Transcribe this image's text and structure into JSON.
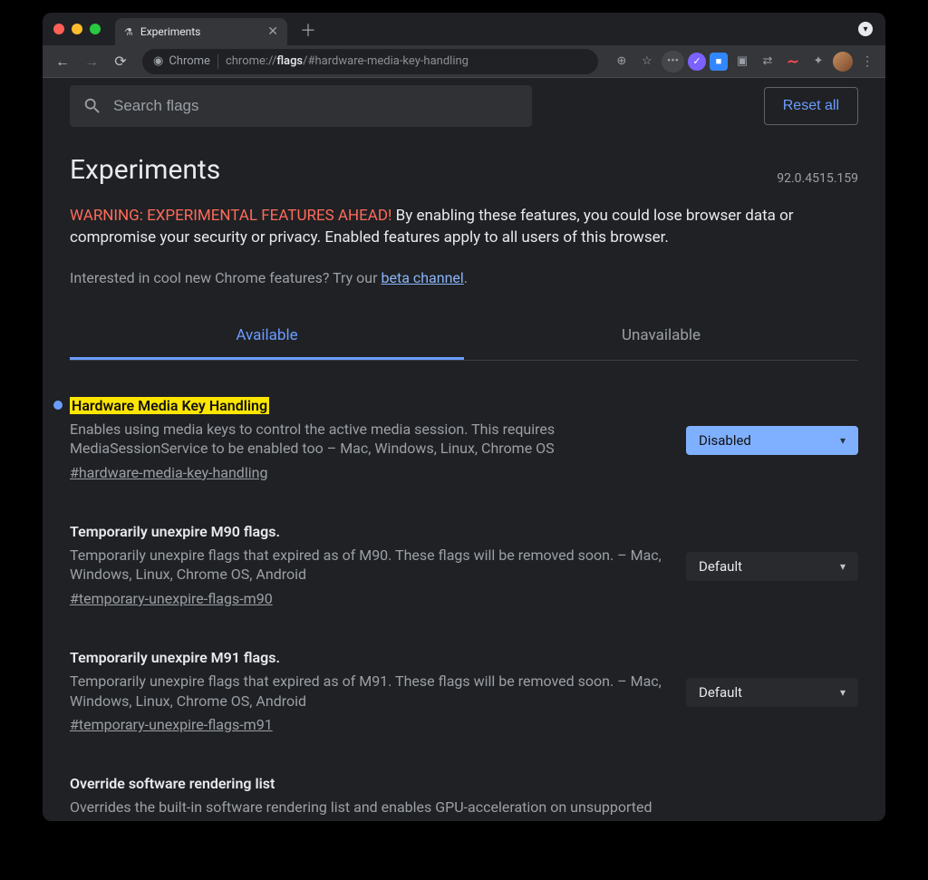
{
  "tab": {
    "title": "Experiments"
  },
  "toolbar": {
    "url_host": "Chrome",
    "url_path_pre": "chrome://",
    "url_path_bold": "flags",
    "url_path_post": "/#hardware-media-key-handling"
  },
  "search": {
    "placeholder": "Search flags"
  },
  "reset_label": "Reset all",
  "page_title": "Experiments",
  "version": "92.0.4515.159",
  "warning_prefix": "WARNING: EXPERIMENTAL FEATURES AHEAD!",
  "warning_body": "By enabling these features, you could lose browser data or compromise your security or privacy. Enabled features apply to all users of this browser.",
  "interest_text": "Interested in cool new Chrome features? Try our ",
  "interest_link": "beta channel",
  "interest_after": ".",
  "tabs": {
    "available": "Available",
    "unavailable": "Unavailable"
  },
  "flags": [
    {
      "title": "Hardware Media Key Handling",
      "highlighted": true,
      "dot": true,
      "desc": "Enables using media keys to control the active media session. This requires MediaSessionService to be enabled too – Mac, Windows, Linux, Chrome OS",
      "anchor": "#hardware-media-key-handling",
      "select": "Disabled",
      "select_hl": true
    },
    {
      "title": "Temporarily unexpire M90 flags.",
      "highlighted": false,
      "dot": false,
      "desc": "Temporarily unexpire flags that expired as of M90. These flags will be removed soon. – Mac, Windows, Linux, Chrome OS, Android",
      "anchor": "#temporary-unexpire-flags-m90",
      "select": "Default",
      "select_hl": false
    },
    {
      "title": "Temporarily unexpire M91 flags.",
      "highlighted": false,
      "dot": false,
      "desc": "Temporarily unexpire flags that expired as of M91. These flags will be removed soon. – Mac, Windows, Linux, Chrome OS, Android",
      "anchor": "#temporary-unexpire-flags-m91",
      "select": "Default",
      "select_hl": false
    },
    {
      "title": "Override software rendering list",
      "highlighted": false,
      "dot": false,
      "desc": "Overrides the built-in software rendering list and enables GPU-acceleration on unsupported",
      "anchor": "",
      "select": "",
      "select_hl": false
    }
  ]
}
